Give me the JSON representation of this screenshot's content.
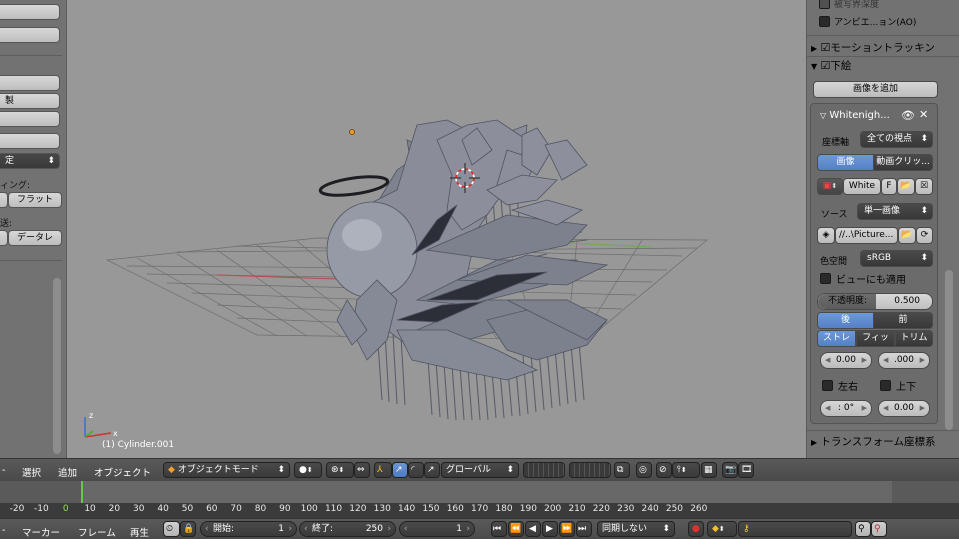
{
  "left_panel": {
    "items": [
      {
        "label": ""
      },
      {
        "label": ""
      },
      {
        "label": ""
      },
      {
        "label": "製"
      },
      {
        "label": ""
      },
      {
        "label": ""
      },
      {
        "label": "定"
      }
    ],
    "shading_label": "ィング:",
    "shading_flat": "フラット",
    "send_label": "送:",
    "send_data": "データレ"
  },
  "viewport": {
    "object_info": "(1) Cylinder.001",
    "axis_x": "x",
    "axis_z": "z"
  },
  "right_panel": {
    "dof": "被写界深度",
    "ao": "アンビエ...ョン(AO)",
    "motion_tracking": "モーショントラッキン",
    "background_images": "下絵",
    "add_image": "画像を追加",
    "image_name": "Whitenigh...",
    "axis_label": "座標軸",
    "axis_value": "全ての視点",
    "tab_image": "画像",
    "tab_movie": "動画クリッ...",
    "img_datablock": "White",
    "img_f": "F",
    "source_label": "ソース",
    "source_value": "単一画像",
    "filepath": "//..\\Picture...",
    "colorspace_label": "色空間",
    "colorspace_value": "sRGB",
    "view_as_render": "ビューにも適用",
    "opacity_label": "不透明度:",
    "opacity_value": "0.500",
    "back": "後",
    "front": "前",
    "stretch": "ストレ",
    "fit": "フィッ",
    "crop": "トリム",
    "offset_x": "0.00",
    "offset_y": ".000",
    "flip_x": "左右",
    "flip_y": "上下",
    "rotation": "0°",
    "rotation_prefix": ":",
    "size": "0.00",
    "transform_orient": "トランスフォーム座標系"
  },
  "header3d": {
    "menu_start": "-",
    "select": "選択",
    "add": "追加",
    "object": "オブジェクト",
    "mode": "オブジェクトモード",
    "orientation": "グローバル"
  },
  "timeline": {
    "ticks": [
      "-20",
      "-10",
      "0",
      "10",
      "20",
      "30",
      "40",
      "50",
      "60",
      "70",
      "80",
      "90",
      "100",
      "110",
      "120",
      "130",
      "140",
      "150",
      "160",
      "170",
      "180",
      "190",
      "200",
      "210",
      "220",
      "230",
      "240",
      "250",
      "260"
    ],
    "current": "0"
  },
  "header_bottom": {
    "menu_start": "-",
    "marker": "マーカー",
    "frame": "フレーム",
    "playback": "再生",
    "start_label": "開始:",
    "start_value": "1",
    "end_label": "終了:",
    "end_value": "250",
    "current_frame": "1",
    "sync": "同期しない"
  },
  "colors": {
    "viewport_bg": "#989898",
    "panel_bg": "#727272",
    "header_bg": "#4a4a4a",
    "accent_blue": "#5680c6",
    "timeline_cursor": "#5fcf3f"
  }
}
